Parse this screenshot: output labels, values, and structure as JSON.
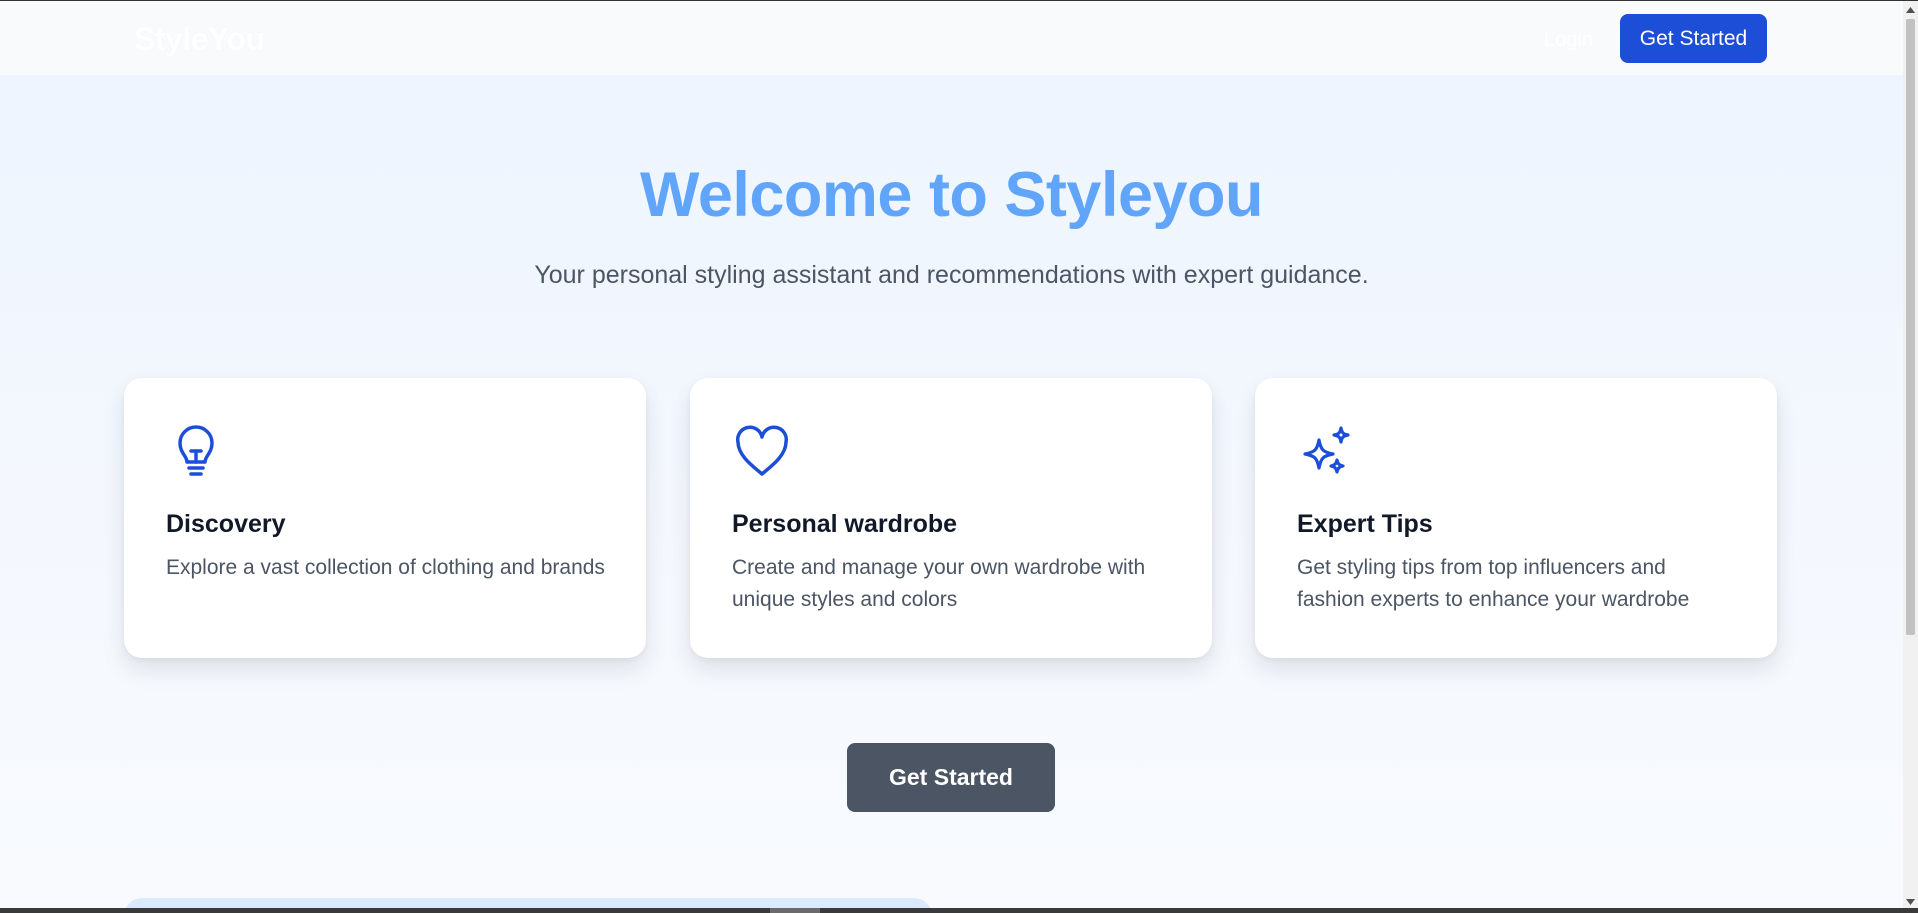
{
  "header": {
    "brand": "StyleYou",
    "login_label": "Login",
    "cta_label": "Get Started"
  },
  "hero": {
    "title": "Welcome to Styleyou",
    "subtitle": "Your personal styling assistant and recommendations with expert guidance."
  },
  "features": [
    {
      "icon": "lightbulb-icon",
      "title": "Discovery",
      "description": "Explore a vast collection of clothing and brands"
    },
    {
      "icon": "heart-icon",
      "title": "Personal wardrobe",
      "description": "Create and manage your own wardrobe with unique styles and colors"
    },
    {
      "icon": "sparkles-icon",
      "title": "Expert Tips",
      "description": "Get styling tips from top influencers and fashion experts to enhance your wardrobe"
    }
  ],
  "main_cta": {
    "label": "Get Started"
  },
  "colors": {
    "brand_blue": "#1d4ed8",
    "accent_blue": "#60a5fa",
    "icon_blue": "#1d4ed8",
    "cta_gray": "#4b5563"
  }
}
